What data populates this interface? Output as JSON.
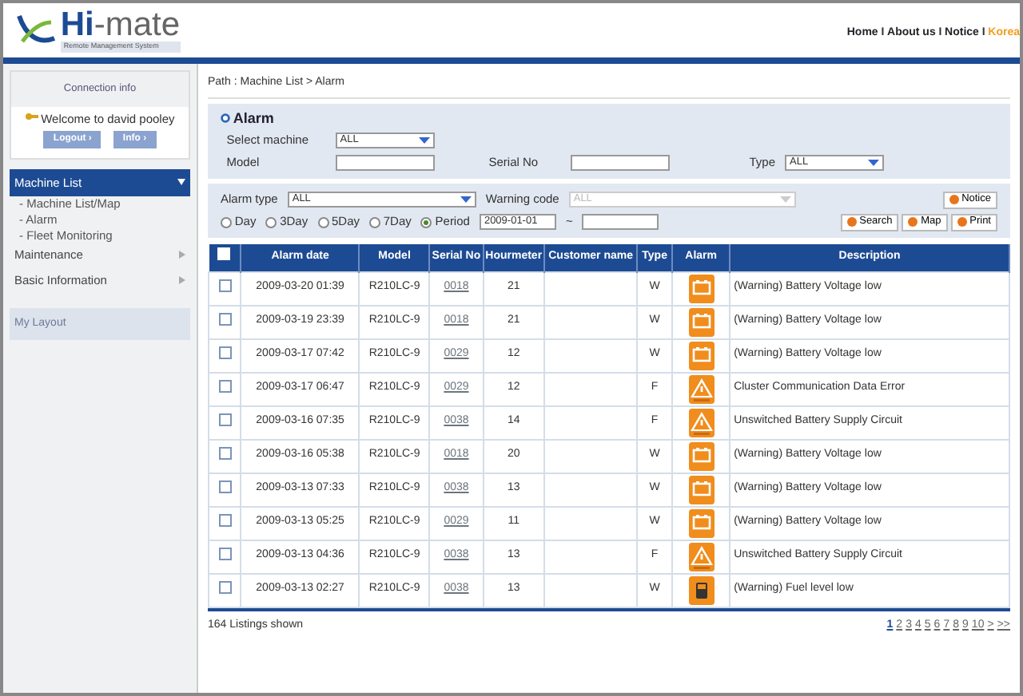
{
  "header": {
    "logo": {
      "name": "Hi-mate",
      "subtitle": "Remote Management System"
    },
    "links": [
      {
        "label": "Home",
        "highlight": false
      },
      {
        "label": "About us",
        "highlight": false
      },
      {
        "label": "Notice",
        "highlight": false
      },
      {
        "label": "Korea",
        "highlight": true
      }
    ],
    "separators": [
      "I",
      "I",
      "I"
    ]
  },
  "sidebar": {
    "connection": {
      "title": "Connection info",
      "welcome": "Welcome to david pooley",
      "buttons": [
        "Logout ›",
        "Info ›"
      ]
    },
    "menu": [
      {
        "label": "Machine List",
        "expanded": true,
        "selected": true,
        "children": [
          {
            "label": "- Machine List/Map"
          },
          {
            "label": "- Alarm"
          },
          {
            "label": "- Fleet Monitoring"
          }
        ]
      },
      {
        "label": "Maintenance",
        "expanded": false,
        "selected": false
      },
      {
        "label": "Basic Information",
        "expanded": false,
        "selected": false
      }
    ],
    "my_layout": "My Layout"
  },
  "path": "Path : Machine List > Alarm",
  "panel": {
    "title": "Alarm",
    "select_machine": {
      "label": "Select machine",
      "value": "ALL"
    },
    "model": {
      "label": "Model"
    },
    "serial_no": {
      "label": "Serial No"
    },
    "type": {
      "label": "Type",
      "value": "ALL"
    },
    "alarm_type": {
      "label": "Alarm type",
      "value": "ALL"
    },
    "warning_code": {
      "label": "Warning code",
      "value": "ALL",
      "disabled": true
    },
    "notice_button": "Notice",
    "periods": [
      {
        "label": "Day",
        "selected": false
      },
      {
        "label": "3Day",
        "selected": false
      },
      {
        "label": "5Day",
        "selected": false
      },
      {
        "label": "7Day",
        "selected": false
      },
      {
        "label": "Period",
        "selected": true
      }
    ],
    "date_from": "2009-01-01",
    "date_sep": "~",
    "buttons": [
      "Search",
      "Map",
      "Print"
    ]
  },
  "table": {
    "select_all_checked": false,
    "columns": [
      "Alarm date",
      "Model",
      "Serial No",
      "Hourmeter",
      "Customer name",
      "Type",
      "Alarm",
      "Description"
    ],
    "rows": [
      {
        "checked": false,
        "date": "2009-03-20 01:39",
        "model": "R210LC-9",
        "serial": "0018",
        "hours": "21",
        "type": "W",
        "kind": "battery",
        "description": "(Warning) Battery Voltage low"
      },
      {
        "checked": false,
        "date": "2009-03-19 23:39",
        "model": "R210LC-9",
        "serial": "0018",
        "hours": "21",
        "type": "W",
        "kind": "battery",
        "description": "(Warning) Battery Voltage low"
      },
      {
        "checked": false,
        "date": "2009-03-17 07:42",
        "model": "R210LC-9",
        "serial": "0029",
        "hours": "12",
        "type": "W",
        "kind": "battery",
        "description": "(Warning) Battery Voltage low"
      },
      {
        "checked": false,
        "date": "2009-03-17 06:47",
        "model": "R210LC-9",
        "serial": "0029",
        "hours": "12",
        "type": "F",
        "kind": "fault",
        "description": "Cluster Communication Data Error"
      },
      {
        "checked": false,
        "date": "2009-03-16 07:35",
        "model": "R210LC-9",
        "serial": "0038",
        "hours": "14",
        "type": "F",
        "kind": "fault",
        "description": "Unswitched Battery Supply Circuit"
      },
      {
        "checked": false,
        "date": "2009-03-16 05:38",
        "model": "R210LC-9",
        "serial": "0018",
        "hours": "20",
        "type": "W",
        "kind": "battery",
        "description": "(Warning) Battery Voltage low"
      },
      {
        "checked": false,
        "date": "2009-03-13 07:33",
        "model": "R210LC-9",
        "serial": "0038",
        "hours": "13",
        "type": "W",
        "kind": "battery",
        "description": "(Warning) Battery Voltage low"
      },
      {
        "checked": false,
        "date": "2009-03-13 05:25",
        "model": "R210LC-9",
        "serial": "0029",
        "hours": "11",
        "type": "W",
        "kind": "battery",
        "description": "(Warning) Battery Voltage low"
      },
      {
        "checked": false,
        "date": "2009-03-13 04:36",
        "model": "R210LC-9",
        "serial": "0038",
        "hours": "13",
        "type": "F",
        "kind": "fault",
        "description": "Unswitched Battery Supply Circuit"
      },
      {
        "checked": false,
        "date": "2009-03-13 02:27",
        "model": "R210LC-9",
        "serial": "0038",
        "hours": "13",
        "type": "W",
        "kind": "fuel",
        "description": "(Warning) Fuel level low"
      }
    ]
  },
  "footer": {
    "count": "164 Listings shown",
    "pages": [
      {
        "label": "1",
        "selected": true
      },
      {
        "label": "2",
        "selected": false
      },
      {
        "label": "3",
        "selected": false
      },
      {
        "label": "4",
        "selected": false
      },
      {
        "label": "5",
        "selected": false
      },
      {
        "label": "6",
        "selected": false
      },
      {
        "label": "7",
        "selected": false
      },
      {
        "label": "8",
        "selected": false
      },
      {
        "label": "9",
        "selected": false
      },
      {
        "label": "10",
        "selected": false
      },
      {
        "label": ">",
        "selected": false
      },
      {
        "label": ">>",
        "selected": false
      }
    ]
  }
}
